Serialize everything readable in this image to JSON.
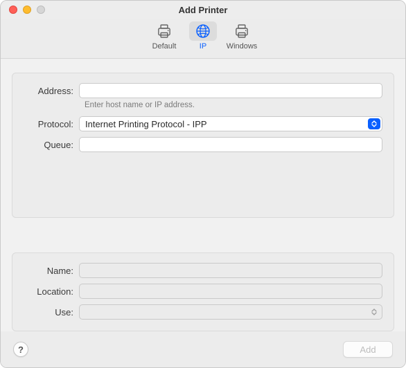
{
  "accent": "#0a60ff",
  "window": {
    "title": "Add Printer"
  },
  "toolbar": {
    "items": [
      {
        "id": "default",
        "label": "Default",
        "active": false
      },
      {
        "id": "ip",
        "label": "IP",
        "active": true
      },
      {
        "id": "windows",
        "label": "Windows",
        "active": false
      }
    ]
  },
  "form": {
    "address": {
      "label": "Address:",
      "value": "",
      "hint": "Enter host name or IP address."
    },
    "protocol": {
      "label": "Protocol:",
      "value": "Internet Printing Protocol - IPP"
    },
    "queue": {
      "label": "Queue:",
      "value": ""
    },
    "name": {
      "label": "Name:",
      "value": ""
    },
    "location": {
      "label": "Location:",
      "value": ""
    },
    "use": {
      "label": "Use:",
      "value": ""
    }
  },
  "footer": {
    "help": "?",
    "add": "Add",
    "add_enabled": false
  }
}
